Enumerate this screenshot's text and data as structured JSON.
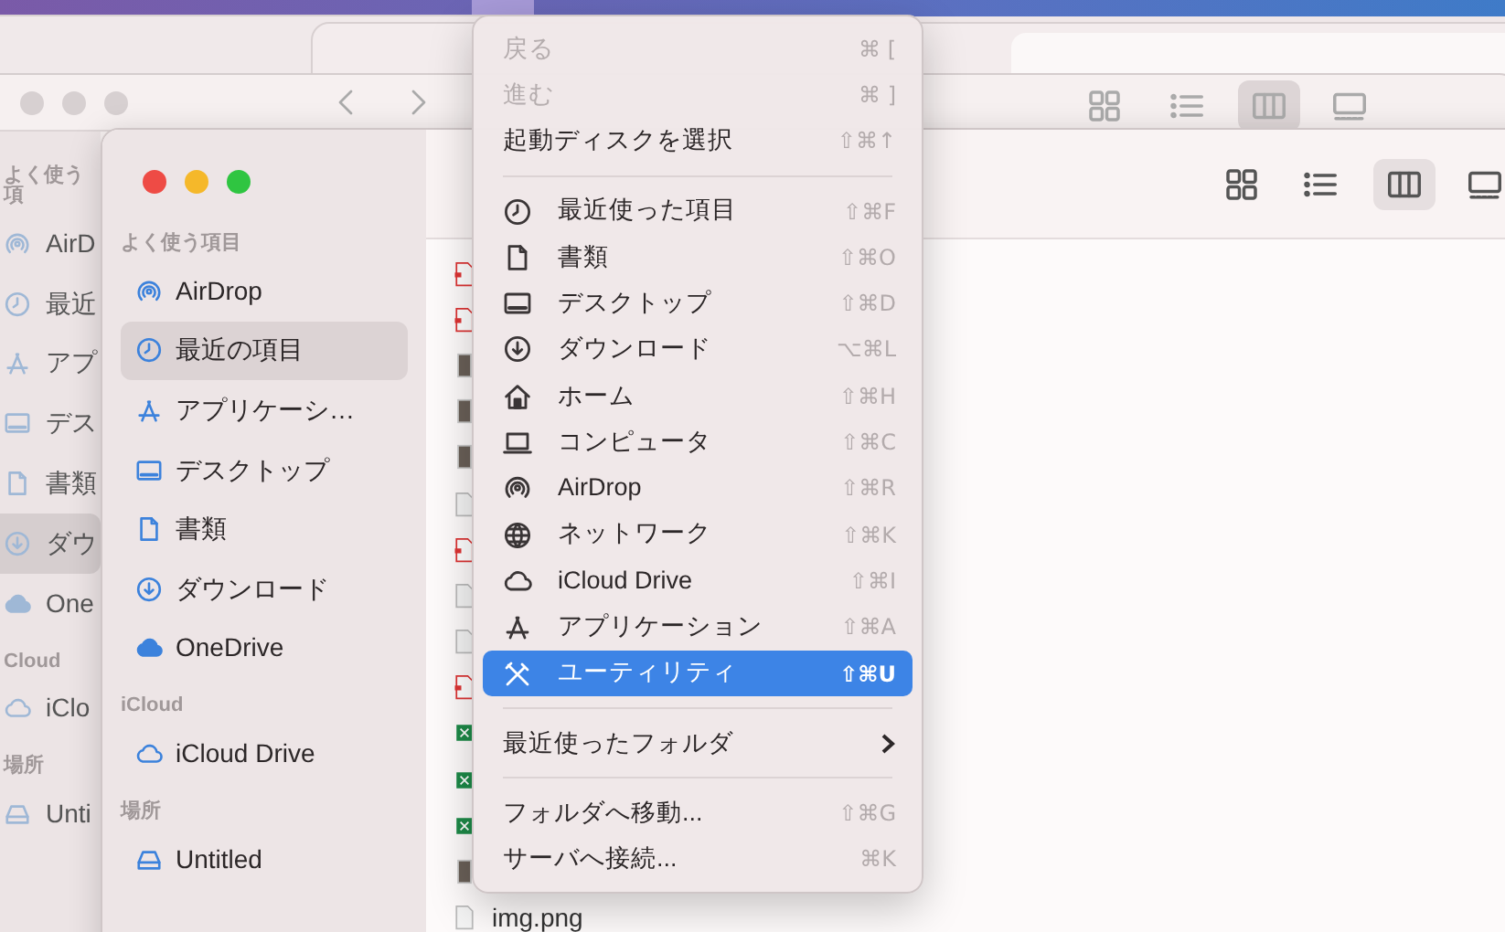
{
  "background_window": {
    "sidebar_sections": [
      {
        "title": "よく使う項",
        "items": [
          {
            "label": "AirD",
            "kind": "airdrop",
            "selected": false
          },
          {
            "label": "最近",
            "kind": "clock",
            "selected": false
          },
          {
            "label": "アプ",
            "kind": "apps",
            "selected": false
          },
          {
            "label": "デス",
            "kind": "desktop",
            "selected": false
          },
          {
            "label": "書類",
            "kind": "doc",
            "selected": false
          },
          {
            "label": "ダウ",
            "kind": "download",
            "selected": true
          },
          {
            "label": "One",
            "kind": "cloudfill",
            "selected": false
          }
        ]
      },
      {
        "title": "Cloud",
        "items": [
          {
            "label": "iClo",
            "kind": "cloud",
            "selected": false
          }
        ]
      },
      {
        "title": "場所",
        "items": [
          {
            "label": "Unti",
            "kind": "drive",
            "selected": false
          }
        ]
      }
    ],
    "view_buttons": [
      {
        "kind": "grid",
        "selected": false
      },
      {
        "kind": "list",
        "selected": false
      },
      {
        "kind": "columns",
        "selected": true
      },
      {
        "kind": "gallery",
        "selected": false
      }
    ]
  },
  "front_window": {
    "sidebar_sections": [
      {
        "title": "よく使う項目",
        "items": [
          {
            "label": "AirDrop",
            "kind": "airdrop",
            "selected": false
          },
          {
            "label": "最近の項目",
            "kind": "clock",
            "selected": true
          },
          {
            "label": "アプリケーシ…",
            "kind": "apps",
            "selected": false
          },
          {
            "label": "デスクトップ",
            "kind": "desktop",
            "selected": false
          },
          {
            "label": "書類",
            "kind": "doc",
            "selected": false
          },
          {
            "label": "ダウンロード",
            "kind": "download",
            "selected": false
          },
          {
            "label": "OneDrive",
            "kind": "cloudfill",
            "selected": false
          }
        ]
      },
      {
        "title": "iCloud",
        "items": [
          {
            "label": "iCloud Drive",
            "kind": "cloud",
            "selected": false
          }
        ]
      },
      {
        "title": "場所",
        "items": [
          {
            "label": "Untitled",
            "kind": "drive",
            "selected": false
          }
        ]
      }
    ],
    "view_buttons": [
      {
        "kind": "grid",
        "selected": false
      },
      {
        "kind": "list",
        "selected": false
      },
      {
        "kind": "columns",
        "selected": true
      },
      {
        "kind": "gallery",
        "selected": false
      }
    ],
    "files": [
      {
        "kind": "pdf"
      },
      {
        "kind": "pdf"
      },
      {
        "kind": "photo"
      },
      {
        "kind": "photo"
      },
      {
        "kind": "photo"
      },
      {
        "kind": "page"
      },
      {
        "kind": "pdf"
      },
      {
        "kind": "page"
      },
      {
        "kind": "page"
      },
      {
        "kind": "pdf"
      },
      {
        "kind": "sheet"
      },
      {
        "kind": "sheet"
      },
      {
        "kind": "sheet"
      },
      {
        "kind": "photo"
      },
      {
        "kind": "page",
        "label": "img.png"
      }
    ]
  },
  "menu": {
    "groups": [
      {
        "kind": "plain",
        "items": [
          {
            "label": "戻る",
            "shortcut": "⌘ [",
            "disabled": true,
            "selected": false
          },
          {
            "label": "進む",
            "shortcut": "⌘ ]",
            "disabled": true,
            "selected": false
          },
          {
            "label": "起動ディスクを選択",
            "shortcut": "⇧⌘↑",
            "disabled": false,
            "selected": false
          }
        ]
      },
      {
        "kind": "places",
        "items": [
          {
            "kind": "clock",
            "label": "最近使った項目",
            "shortcut": "⇧⌘F",
            "selected": false
          },
          {
            "kind": "doc",
            "label": "書類",
            "shortcut": "⇧⌘O",
            "selected": false
          },
          {
            "kind": "desktop",
            "label": "デスクトップ",
            "shortcut": "⇧⌘D",
            "selected": false
          },
          {
            "kind": "download",
            "label": "ダウンロード",
            "shortcut": "⌥⌘L",
            "selected": false
          },
          {
            "kind": "home",
            "label": "ホーム",
            "shortcut": "⇧⌘H",
            "selected": false
          },
          {
            "kind": "laptop",
            "label": "コンピュータ",
            "shortcut": "⇧⌘C",
            "selected": false
          },
          {
            "kind": "airdrop",
            "label": "AirDrop",
            "shortcut": "⇧⌘R",
            "selected": false
          },
          {
            "kind": "globe",
            "label": "ネットワーク",
            "shortcut": "⇧⌘K",
            "selected": false
          },
          {
            "kind": "cloud",
            "label": "iCloud Drive",
            "shortcut": "⇧⌘I",
            "selected": false
          },
          {
            "kind": "apps",
            "label": "アプリケーション",
            "shortcut": "⇧⌘A",
            "selected": false
          },
          {
            "kind": "tools",
            "label": "ユーティリティ",
            "shortcut": "⇧⌘U",
            "selected": true
          }
        ]
      },
      {
        "kind": "submenus",
        "items": [
          {
            "label": "最近使ったフォルダ",
            "selected": false
          }
        ]
      },
      {
        "kind": "plain",
        "items": [
          {
            "label": "フォルダへ移動...",
            "shortcut": "⇧⌘G",
            "disabled": false,
            "selected": false
          },
          {
            "label": "サーバへ接続...",
            "shortcut": "⌘K",
            "disabled": false,
            "selected": false
          }
        ]
      }
    ]
  }
}
